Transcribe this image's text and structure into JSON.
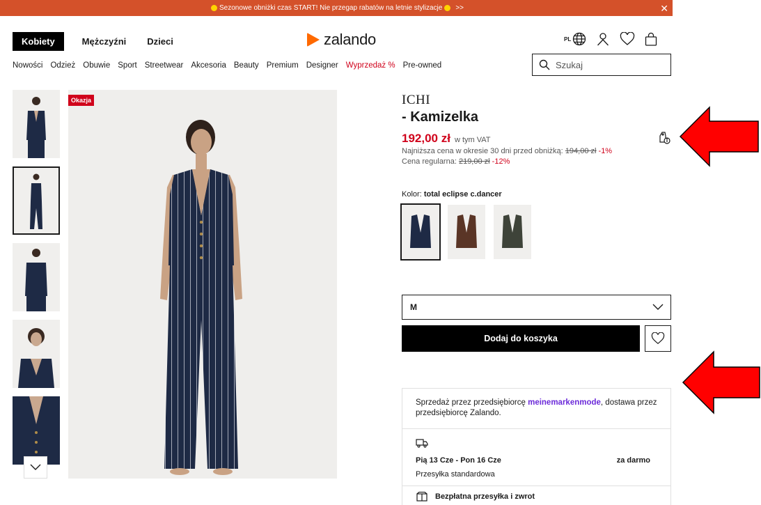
{
  "promo": {
    "text": "Sezonowe obniżki czas START! Nie przegap rabatów na letnie stylizacje",
    "suffix": ">>"
  },
  "gender_nav": [
    "Kobiety",
    "Mężczyźni",
    "Dzieci"
  ],
  "logo_text": "zalando",
  "header": {
    "locale": "PL",
    "icons": [
      "globe-icon",
      "user-icon",
      "heart-icon",
      "bag-icon"
    ]
  },
  "categories": [
    "Nowości",
    "Odzież",
    "Obuwie",
    "Sport",
    "Streetwear",
    "Akcesoria",
    "Beauty",
    "Premium",
    "Designer",
    "Wyprzedaż %",
    "Pre-owned"
  ],
  "search": {
    "placeholder": "Szukaj"
  },
  "product": {
    "badge": "Okazja",
    "brand": "ICHI",
    "name": "- Kamizelka",
    "price": "192,00 zł",
    "vat": "w tym VAT",
    "lowest_label": "Najniższa cena w okresie 30 dni przed obniżką:",
    "lowest_price": "194,00 zł",
    "lowest_pct": "-1%",
    "regular_label": "Cena regularna:",
    "regular_price": "219,00 zł",
    "regular_pct": "-12%",
    "color_label": "Kolor:",
    "color_value": "total eclipse c.dancer",
    "size": "M",
    "add_to_cart": "Dodaj do koszyka"
  },
  "seller": {
    "prefix": "Sprzedaż przez przedsiębiorcę",
    "name": "meinemarkenmode",
    "suffix": ", dostawa przez przedsiębiorcę Zalando."
  },
  "delivery": {
    "dates": "Pią 13 Cze - Pon 16 Cze",
    "cost": "za darmo",
    "type": "Przesyłka standardowa"
  },
  "returns": {
    "label": "Bezpłatna przesyłka i zwrot"
  },
  "colors": {
    "accent": "#d0021b",
    "promo_bg": "#d4512a",
    "brand_orange": "#ff6900",
    "seller_link": "#6c2bd9",
    "annotation_arrow": "#ff0000"
  }
}
